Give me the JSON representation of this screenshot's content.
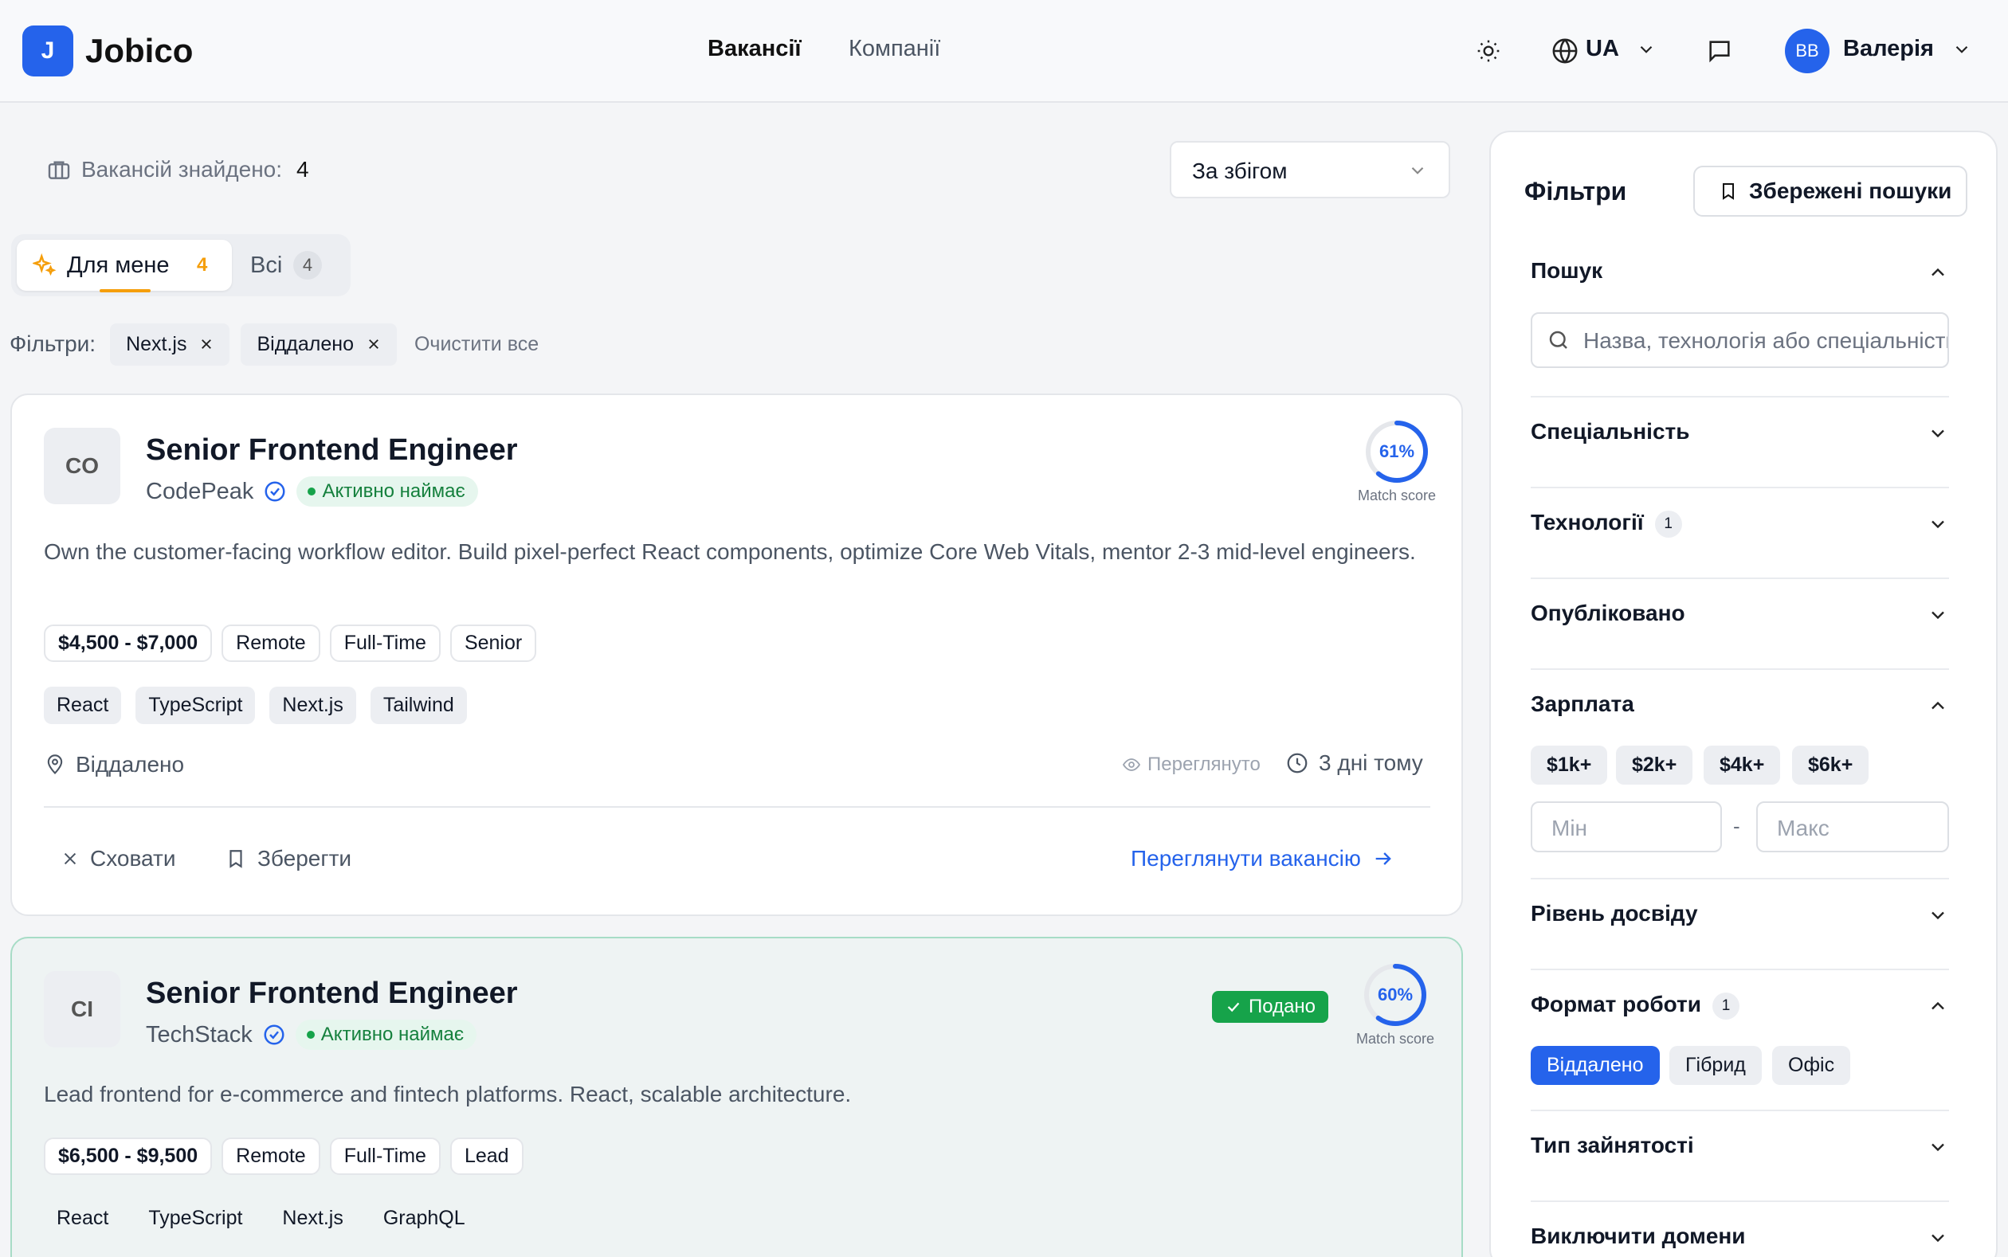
{
  "app": {
    "logo_mark": "J",
    "name": "Jobico"
  },
  "nav": {
    "vacancies": "Вакансії",
    "companies": "Компанії"
  },
  "header": {
    "lang": "UA",
    "user_initials": "BB",
    "user_name": "Валерія"
  },
  "results": {
    "label": "Вакансій знайдено:",
    "count": "4",
    "sort": "За збігом"
  },
  "tabs": {
    "for_me": "Для мене",
    "for_me_count": "4",
    "all": "Всі",
    "all_count": "4"
  },
  "active_filters": {
    "label": "Фільтри:",
    "chips": [
      "Next.js",
      "Віддалено"
    ],
    "clear": "Очистити все"
  },
  "jobs": [
    {
      "logo": "CO",
      "title": "Senior Frontend Engineer",
      "company": "CodePeak",
      "hiring": "Активно наймає",
      "description": "Own the customer-facing workflow editor. Build pixel-perfect React components, optimize Core Web Vitals, mentor 2-3 mid-level engineers.",
      "salary": "$4,500 - $7,000",
      "tags": [
        "Remote",
        "Full-Time",
        "Senior"
      ],
      "tech": [
        "React",
        "TypeScript",
        "Next.js",
        "Tailwind"
      ],
      "location": "Віддалено",
      "viewed": "Переглянуто",
      "posted": "3 дні тому",
      "score": "61%",
      "score_value": 61,
      "score_label": "Match score",
      "hide": "Сховати",
      "save": "Зберегти",
      "view": "Переглянути вакансію"
    },
    {
      "logo": "CI",
      "title": "Senior Frontend Engineer",
      "company": "TechStack",
      "hiring": "Активно наймає",
      "description": "Lead frontend for e-commerce and fintech platforms. React, scalable architecture.",
      "salary": "$6,500 - $9,500",
      "tags": [
        "Remote",
        "Full-Time",
        "Lead"
      ],
      "tech": [
        "React",
        "TypeScript",
        "Next.js",
        "GraphQL"
      ],
      "status": "Подано",
      "score": "60%",
      "score_value": 60,
      "score_label": "Match score"
    }
  ],
  "filters": {
    "title": "Фільтри",
    "saved": "Збережені пошуки",
    "search": {
      "label": "Пошук",
      "placeholder": "Назва, технологія або спеціальність"
    },
    "specialty": "Спеціальність",
    "technologies": {
      "label": "Технології",
      "count": "1"
    },
    "published": "Опубліковано",
    "salary": {
      "label": "Зарплата",
      "presets": [
        "$1k+",
        "$2k+",
        "$4k+",
        "$6k+"
      ],
      "min": "Мін",
      "max": "Макс",
      "sep": "-"
    },
    "experience": "Рівень досвіду",
    "work_format": {
      "label": "Формат роботи",
      "count": "1",
      "options": [
        "Віддалено",
        "Гібрид",
        "Офіс"
      ],
      "selected": "Віддалено"
    },
    "employment": "Тип зайнятості",
    "exclude_domains": "Виключити домени"
  },
  "colors": {
    "accent": "#2563eb",
    "success": "#16a34a",
    "orange": "#f59e0b"
  }
}
